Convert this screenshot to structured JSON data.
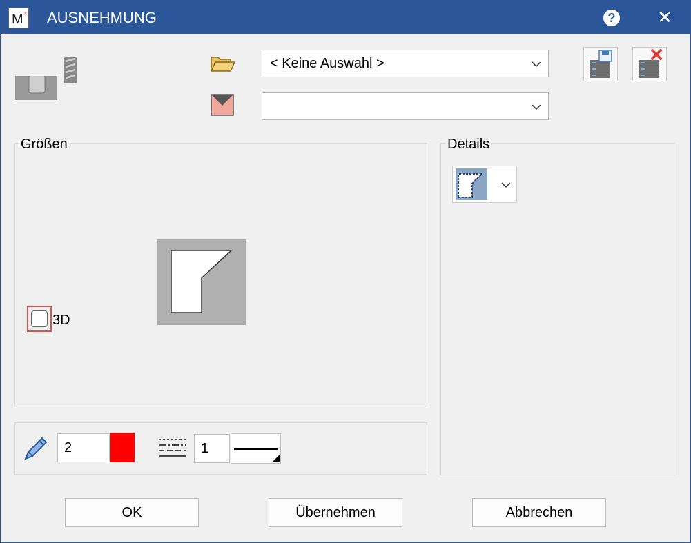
{
  "window": {
    "title": "AUSNEHMUNG",
    "app_icon_letter": "M",
    "help_symbol": "?",
    "close_symbol": "✕"
  },
  "top": {
    "selection_combo": {
      "value": "< Keine Auswahl >"
    },
    "second_combo": {
      "value": ""
    }
  },
  "groups": {
    "sizes_label": "Größen",
    "details_label": "Details"
  },
  "sizes": {
    "checkbox_3d_label": "3D",
    "checkbox_3d_checked": false
  },
  "pen": {
    "width_value": "2",
    "color": "#ff0000",
    "line_type_value": "1"
  },
  "buttons": {
    "ok": "OK",
    "apply": "Übernehmen",
    "cancel": "Abbrechen"
  },
  "colors": {
    "titlebar": "#2b579a",
    "accent_red": "#ff0000",
    "highlight": "#d9534f"
  }
}
